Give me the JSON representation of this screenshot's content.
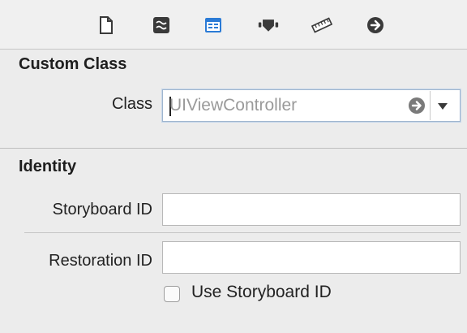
{
  "toolbar": {
    "icons": [
      {
        "name": "file-inspector-icon"
      },
      {
        "name": "quick-help-icon"
      },
      {
        "name": "identity-inspector-icon",
        "active": true
      },
      {
        "name": "attributes-inspector-icon"
      },
      {
        "name": "size-inspector-icon"
      },
      {
        "name": "connections-inspector-icon"
      }
    ]
  },
  "custom_class": {
    "title": "Custom Class",
    "class_label": "Class",
    "class_value": "UIViewController"
  },
  "identity": {
    "title": "Identity",
    "storyboard_id_label": "Storyboard ID",
    "storyboard_id_value": "",
    "restoration_id_label": "Restoration ID",
    "restoration_id_value": "",
    "use_storyboard_id_label": "Use Storyboard ID",
    "use_storyboard_id_checked": false
  },
  "colors": {
    "active_icon": "#2b7bd6",
    "inactive_icon": "#3a3a3a"
  }
}
